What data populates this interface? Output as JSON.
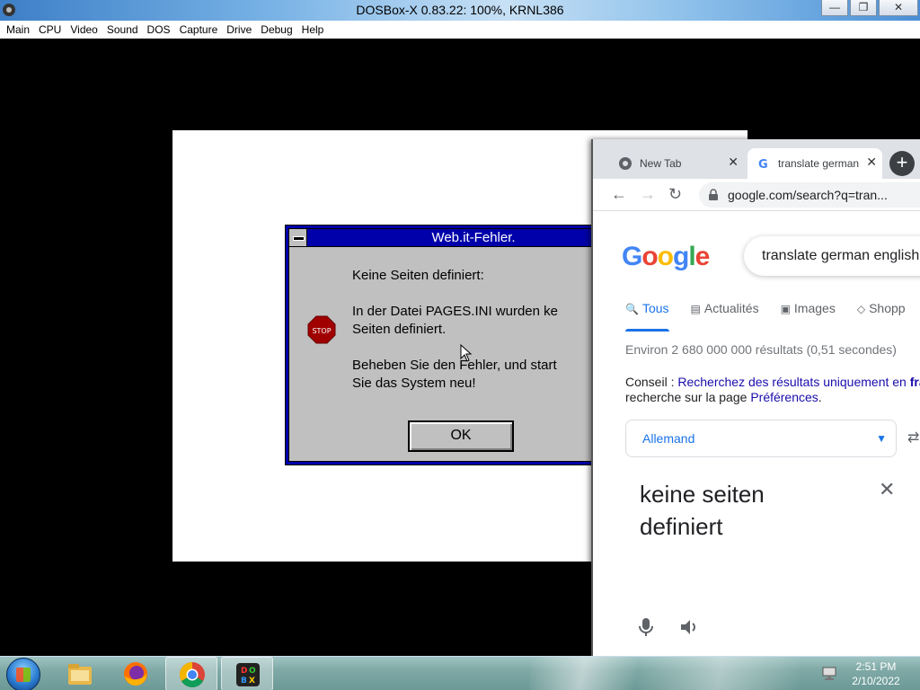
{
  "dosbox": {
    "title": "DOSBox-X 0.83.22: 100%, KRNL386",
    "menu": [
      "Main",
      "CPU",
      "Video",
      "Sound",
      "DOS",
      "Capture",
      "Drive",
      "Debug",
      "Help"
    ],
    "controls": {
      "minimize": "—",
      "restore": "❐",
      "close": "✕"
    }
  },
  "dialog": {
    "title": "Web.it-Fehler.",
    "line1": "Keine Seiten definiert:",
    "line2": "In der Datei PAGES.INI wurden ke",
    "line3": "Seiten definiert.",
    "line4": "Beheben Sie den Fehler, und start",
    "line5": "Sie das System neu!",
    "ok_label": "OK",
    "icon": "stop-sign-icon",
    "stop_text": "STOP"
  },
  "chrome": {
    "tabs": [
      {
        "title": "New Tab",
        "icon": "chrome-icon"
      },
      {
        "title": "translate german",
        "icon": "google-g-icon"
      }
    ],
    "tab_close": "✕",
    "new_tab": "+",
    "url": "google.com/search?q=tran...",
    "nav": {
      "back": "←",
      "forward": "→",
      "reload": "↻"
    }
  },
  "google": {
    "logo": [
      "G",
      "o",
      "o",
      "g",
      "l",
      "e"
    ],
    "logo_colors": [
      "#4285f4",
      "#ea4335",
      "#fbbc05",
      "#4285f4",
      "#34a853",
      "#ea4335"
    ],
    "query": "translate german english",
    "tabs": [
      {
        "label": "Tous",
        "icon": "search-icon",
        "glyph": "🔍"
      },
      {
        "label": "Actualités",
        "icon": "news-icon",
        "glyph": "▤"
      },
      {
        "label": "Images",
        "icon": "image-icon",
        "glyph": "▣"
      },
      {
        "label": "Shopp",
        "icon": "tag-icon",
        "glyph": "◇"
      }
    ],
    "results_count": "Environ 2 680 000 000 résultats (0,51 secondes)",
    "tip_label": "Conseil : ",
    "tip_link": "Recherchez des résultats uniquement en",
    "tip_bold": "fra",
    "tip_line2_prefix": "recherche sur la page ",
    "tip_line2_link": "Préférences",
    "tip_line2_suffix": ".",
    "source_lang": "Allemand",
    "source_text": "keine seiten definiert",
    "clear": "✕",
    "swap": "⇄"
  },
  "taskbar": {
    "time": "2:51 PM",
    "date": "2/10/2022",
    "apps": [
      "file-explorer-icon",
      "firefox-icon",
      "chrome-icon",
      "dosbox-icon"
    ]
  },
  "colors": {
    "dialog_frame": "#0000aa",
    "link": "#1a0dab",
    "accent": "#1a73e8"
  }
}
